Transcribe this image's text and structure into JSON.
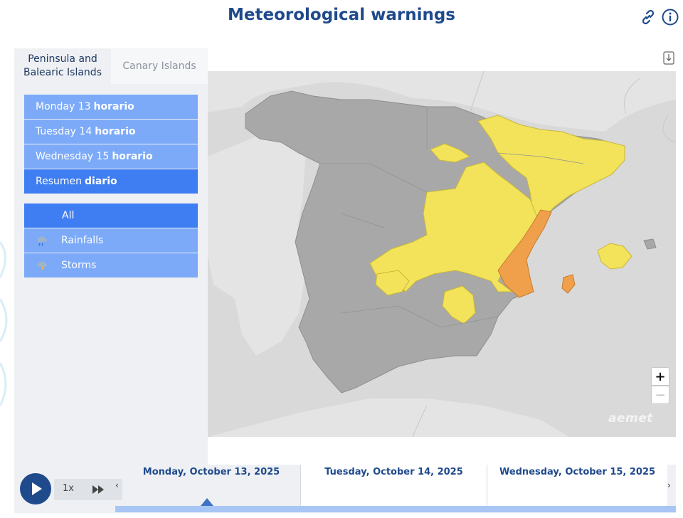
{
  "header": {
    "title": "Meteorological warnings",
    "link_icon": "link-icon",
    "info_icon": "info-icon"
  },
  "tabs": [
    {
      "label": "Peninsula and Balearic Islands",
      "active": true
    },
    {
      "label": "Canary Islands",
      "active": false
    }
  ],
  "days": [
    {
      "prefix": "Monday 13",
      "suffix": "horario",
      "active": false
    },
    {
      "prefix": "Tuesday 14",
      "suffix": "horario",
      "active": false
    },
    {
      "prefix": "Wednesday 15",
      "suffix": "horario",
      "active": false
    },
    {
      "prefix": "Resumen",
      "suffix": "diario",
      "active": true
    }
  ],
  "filters": [
    {
      "label": "All",
      "icon": "",
      "active": true
    },
    {
      "label": "Rainfalls",
      "icon": "rain-icon",
      "active": false
    },
    {
      "label": "Storms",
      "icon": "storm-icon",
      "active": false
    }
  ],
  "map": {
    "zoom_in": "+",
    "zoom_out": "−",
    "watermark": "aemet",
    "download_icon": "download-icon",
    "colors": {
      "no_warning": "#a8a8a8",
      "yellow": "#f2e35a",
      "orange": "#f0a04b",
      "background": "#d9d9d9"
    }
  },
  "timeline": {
    "speed": "1x",
    "prev": "‹",
    "next": "›",
    "days": [
      "Monday, October 13, 2025",
      "Tuesday, October 14, 2025",
      "Wednesday, October 15, 2025"
    ],
    "accent": "#1f4a8c"
  }
}
